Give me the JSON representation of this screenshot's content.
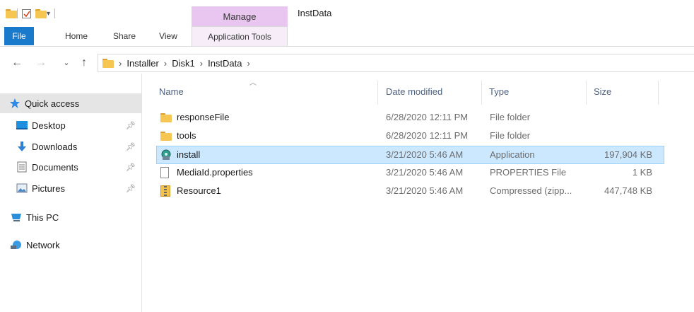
{
  "window": {
    "title": "InstData",
    "context_tab_group": "Manage"
  },
  "ribbon": {
    "tabs": [
      {
        "label": "File"
      },
      {
        "label": "Home"
      },
      {
        "label": "Share"
      },
      {
        "label": "View"
      },
      {
        "label": "Application Tools"
      }
    ]
  },
  "address": {
    "crumbs": [
      "Installer",
      "Disk1",
      "InstData"
    ]
  },
  "nav": {
    "quick_access": "Quick access",
    "items": [
      {
        "label": "Desktop",
        "icon": "desktop-icon",
        "pinned": true
      },
      {
        "label": "Downloads",
        "icon": "downloads-icon",
        "pinned": true
      },
      {
        "label": "Documents",
        "icon": "documents-icon",
        "pinned": true
      },
      {
        "label": "Pictures",
        "icon": "pictures-icon",
        "pinned": true
      }
    ],
    "this_pc": "This PC",
    "network": "Network"
  },
  "columns": {
    "name": "Name",
    "date": "Date modified",
    "type": "Type",
    "size": "Size"
  },
  "files": [
    {
      "name": "responseFile",
      "date": "6/28/2020 12:11 PM",
      "type": "File folder",
      "size": "",
      "icon": "folder-icon",
      "selected": false
    },
    {
      "name": "tools",
      "date": "6/28/2020 12:11 PM",
      "type": "File folder",
      "size": "",
      "icon": "folder-icon",
      "selected": false
    },
    {
      "name": "install",
      "date": "3/21/2020 5:46 AM",
      "type": "Application",
      "size": "197,904 KB",
      "icon": "application-icon",
      "selected": true
    },
    {
      "name": "MediaId.properties",
      "date": "3/21/2020 5:46 AM",
      "type": "PROPERTIES File",
      "size": "1 KB",
      "icon": "document-icon",
      "selected": false
    },
    {
      "name": "Resource1",
      "date": "3/21/2020 5:46 AM",
      "type": "Compressed (zipp...",
      "size": "447,748 KB",
      "icon": "zip-icon",
      "selected": false
    }
  ],
  "colors": {
    "file_tab": "#1979ca",
    "manage_tab": "#e8c6f0",
    "selection_fill": "#cce8ff",
    "selection_border": "#99d1ff",
    "folder": "#f6c653"
  }
}
